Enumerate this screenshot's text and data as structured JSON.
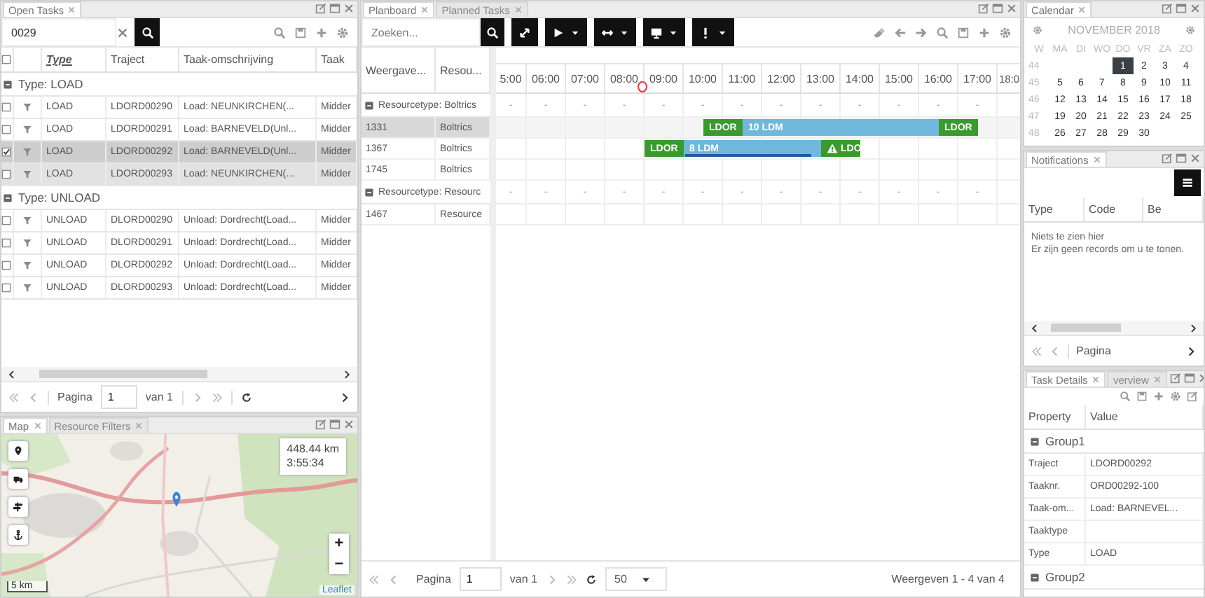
{
  "open_tasks": {
    "tab": "Open Tasks",
    "search": {
      "value": "0029"
    },
    "all_checked": false,
    "columns": [
      {
        "label": "Type",
        "sorted": true
      },
      {
        "label": "Traject",
        "sorted": false
      },
      {
        "label": "Taak-omschrijving",
        "sorted": false
      },
      {
        "label": "Taak",
        "sorted": false
      }
    ],
    "groups": [
      {
        "label": "Type: LOAD",
        "expanded": true,
        "rows": [
          {
            "type": "LOAD",
            "traject": "LDORD00290",
            "description": "Load: NEUNKIRCHEN(...",
            "column_4": "Midder",
            "checked": false,
            "selected": false,
            "hovered": false
          },
          {
            "type": "LOAD",
            "traject": "LDORD00291",
            "description": "Load: BARNEVELD(Unl...",
            "column_4": "Midder",
            "checked": false,
            "selected": false,
            "hovered": false
          },
          {
            "type": "LOAD",
            "traject": "LDORD00292",
            "description": "Load: BARNEVELD(Unl...",
            "column_4": "Midder",
            "checked": true,
            "selected": true,
            "hovered": false
          },
          {
            "type": "LOAD",
            "traject": "LDORD00293",
            "description": "Load: NEUNKIRCHEN(...",
            "column_4": "Midder",
            "checked": false,
            "selected": false,
            "hovered": true
          }
        ]
      },
      {
        "label": "Type: UNLOAD",
        "expanded": true,
        "rows": [
          {
            "type": "UNLOAD",
            "traject": "DLORD00290",
            "description": "Unload: Dordrecht(Load...",
            "column_4": "Midder",
            "checked": false,
            "selected": false,
            "hovered": false
          },
          {
            "type": "UNLOAD",
            "traject": "DLORD00291",
            "description": "Unload: Dordrecht(Load...",
            "column_4": "Midder",
            "checked": false,
            "selected": false,
            "hovered": false
          },
          {
            "type": "UNLOAD",
            "traject": "DLORD00292",
            "description": "Unload: Dordrecht(Load...",
            "column_4": "Midder",
            "checked": false,
            "selected": false,
            "hovered": false
          },
          {
            "type": "UNLOAD",
            "traject": "DLORD00293",
            "description": "Unload: Dordrecht(Load...",
            "column_4": "Midder",
            "checked": false,
            "selected": false,
            "hovered": false
          }
        ]
      }
    ],
    "pager": {
      "label": "Pagina",
      "page": "1",
      "total": "van 1"
    }
  },
  "map": {
    "tabs": [
      {
        "label": "Map",
        "selected": true
      },
      {
        "label": "Resource Filters",
        "selected": false
      }
    ],
    "distance": "448.44 km",
    "duration": "3:55:34",
    "zoom_in": "+",
    "zoom_out": "−",
    "scale": "5 km",
    "attribution": "Leaflet"
  },
  "planboard": {
    "tabs": [
      {
        "label": "Planboard",
        "selected": true
      },
      {
        "label": "Planned Tasks",
        "selected": false
      }
    ],
    "search": {
      "placeholder": "Zoeken..."
    },
    "columns": [
      "Weergave...",
      "Resou..."
    ],
    "hours": [
      "5:00",
      "06:00",
      "07:00",
      "08:00",
      "09:00",
      "10:00",
      "11:00",
      "12:00",
      "13:00",
      "14:00",
      "15:00",
      "16:00",
      "17:00",
      "18:0"
    ],
    "rows": [
      {
        "kind": "group",
        "label": "Resourcetype: Boltrics",
        "expanded": true,
        "cells": [
          "-",
          "-",
          "-",
          "-",
          "-",
          "-",
          "-",
          "-",
          "-",
          "-",
          "-",
          "-",
          "-"
        ]
      },
      {
        "kind": "resource",
        "id": "1331",
        "name": "Boltrics",
        "selected": true,
        "segments": [
          {
            "kind": "stop",
            "label": "LDOR",
            "warning": false
          },
          {
            "kind": "load",
            "label": "10 LDM",
            "warning": false
          },
          {
            "kind": "stop",
            "label": "LDOR",
            "warning": false
          }
        ]
      },
      {
        "kind": "resource",
        "id": "1367",
        "name": "Boltrics",
        "selected": false,
        "segments": [
          {
            "kind": "stop",
            "label": "LDOR",
            "warning": false
          },
          {
            "kind": "load",
            "label": "8 LDM",
            "warning": false,
            "level": 0.97
          },
          {
            "kind": "stop",
            "label": "LDO",
            "warning": true
          }
        ]
      },
      {
        "kind": "resource",
        "id": "1745",
        "name": "Boltrics",
        "selected": false
      },
      {
        "kind": "group",
        "label": "Resourcetype: Resourc",
        "expanded": true,
        "cells": [
          "-",
          "-",
          "-",
          "-",
          "-",
          "-",
          "-",
          "-",
          "-",
          "-",
          "-",
          "-",
          "-"
        ]
      },
      {
        "kind": "resource",
        "id": "1467",
        "name": "Resource",
        "selected": false
      }
    ],
    "pager": {
      "label": "Pagina",
      "page": "1",
      "total": "van 1",
      "page_size": "50",
      "summary": "Weergeven 1 - 4 van 4"
    }
  },
  "calendar": {
    "tab": "Calendar",
    "month": "NOVEMBER 2018",
    "weekdays": [
      "W",
      "MA",
      "DI",
      "WO",
      "DO",
      "VR",
      "ZA",
      "ZO"
    ],
    "weeks": [
      {
        "number": "44",
        "days": [
          {
            "label": "1",
            "selected": true
          },
          {
            "label": "2",
            "selected": false
          },
          {
            "label": "3",
            "selected": false
          },
          {
            "label": "4",
            "selected": false
          }
        ]
      },
      {
        "number": "45",
        "days": [
          {
            "label": "5",
            "selected": false
          },
          {
            "label": "6",
            "selected": false
          },
          {
            "label": "7",
            "selected": false
          },
          {
            "label": "8",
            "selected": false
          },
          {
            "label": "9",
            "selected": false
          },
          {
            "label": "10",
            "selected": false
          },
          {
            "label": "11",
            "selected": false
          }
        ]
      },
      {
        "number": "46",
        "days": [
          {
            "label": "12",
            "selected": false
          },
          {
            "label": "13",
            "selected": false
          },
          {
            "label": "14",
            "selected": false
          },
          {
            "label": "15",
            "selected": false
          },
          {
            "label": "16",
            "selected": false
          },
          {
            "label": "17",
            "selected": false
          },
          {
            "label": "18",
            "selected": false
          }
        ]
      },
      {
        "number": "47",
        "days": [
          {
            "label": "19",
            "selected": false
          },
          {
            "label": "20",
            "selected": false
          },
          {
            "label": "21",
            "selected": false
          },
          {
            "label": "22",
            "selected": false
          },
          {
            "label": "23",
            "selected": false
          },
          {
            "label": "24",
            "selected": false
          },
          {
            "label": "25",
            "selected": false
          }
        ]
      },
      {
        "number": "48",
        "days": [
          {
            "label": "26",
            "selected": false
          },
          {
            "label": "27",
            "selected": false
          },
          {
            "label": "28",
            "selected": false
          },
          {
            "label": "29",
            "selected": false
          },
          {
            "label": "30",
            "selected": false
          }
        ]
      }
    ]
  },
  "notifications": {
    "tab": "Notifications",
    "columns": [
      "Type",
      "Code",
      "Be"
    ],
    "empty_title": "Niets te zien hier",
    "empty_message": "Er zijn geen records om u te tonen.",
    "pager": {
      "label": "Pagina"
    }
  },
  "task_details": {
    "tabs": [
      {
        "label": "Task Details",
        "selected": true
      },
      {
        "label": "verview",
        "selected": false
      }
    ],
    "columns": [
      "Property",
      "Value"
    ],
    "groups": [
      {
        "label": "Group1",
        "expanded": true,
        "rows": [
          {
            "property": "Traject",
            "value": "LDORD00292"
          },
          {
            "property": "Taaknr.",
            "value": "ORD00292-100"
          },
          {
            "property": "Taak-om...",
            "value": "Load: BARNEVEL..."
          },
          {
            "property": "Taaktype"
          },
          {
            "property": "Type",
            "value": "LOAD"
          }
        ]
      },
      {
        "label": "Group2",
        "expanded": true
      }
    ]
  }
}
